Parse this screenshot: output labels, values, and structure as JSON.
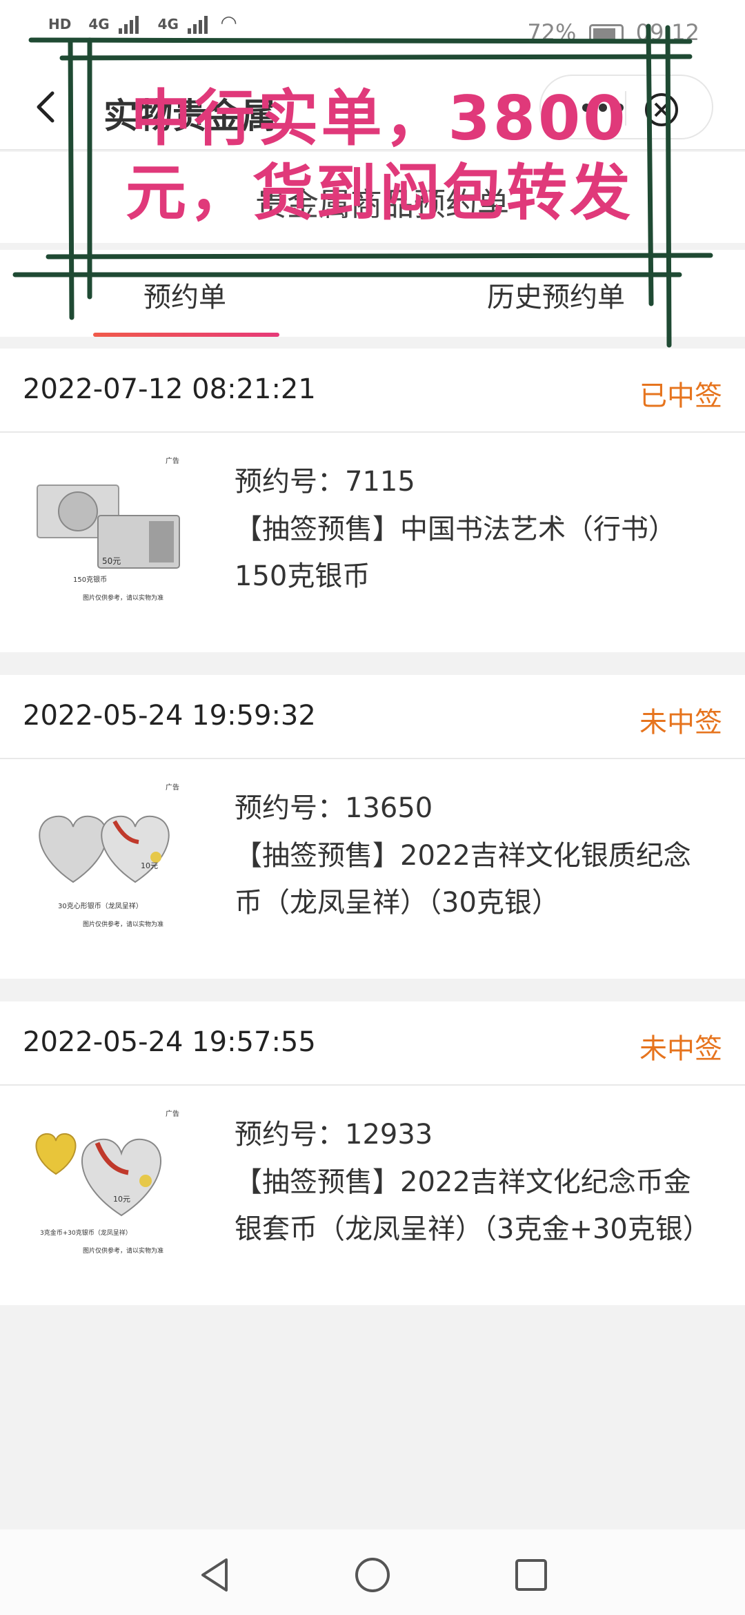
{
  "status_bar": {
    "left_badges": [
      "HD",
      "HD"
    ],
    "network_1": "4G",
    "network_2": "4G",
    "battery": "72%",
    "time": "09:12"
  },
  "titlebar": {
    "title": "实物贵金属",
    "back_icon": "chevron-left-icon",
    "more_icon": "more-dots-icon",
    "close_icon": "close-circle-icon"
  },
  "notice": {
    "text": "贵金属商品预约单"
  },
  "overlay": {
    "line1": "中行实单，3800",
    "line2": "元，货到闷包转发",
    "color": "#e0397a",
    "line_color": "#1f4a33"
  },
  "tabs": [
    {
      "label": "预约单",
      "active": true
    },
    {
      "label": "历史预约单",
      "active": false
    }
  ],
  "orders": [
    {
      "date": "2022-07-12 08:21:21",
      "result": "已中签",
      "reserve_no": "预约号：7115",
      "title": "【抽签预售】中国书法艺术（行书）150克银币",
      "thumb": {
        "ad": "广告",
        "caption": "150克银币",
        "note": "图片仅供参考，请以实物为准",
        "face_value": "50元"
      }
    },
    {
      "date": "2022-05-24 19:59:32",
      "result": "未中签",
      "reserve_no": "预约号：13650",
      "title": "【抽签预售】2022吉祥文化银质纪念币（龙凤呈祥）（30克银）",
      "thumb": {
        "ad": "广告",
        "caption": "30克心形银币（龙凤呈祥）",
        "note": "图片仅供参考，请以实物为准",
        "face_value": "10元"
      }
    },
    {
      "date": "2022-05-24 19:57:55",
      "result": "未中签",
      "reserve_no": "预约号：12933",
      "title": "【抽签预售】2022吉祥文化纪念币金银套币（龙凤呈祥）（3克金+30克银）",
      "thumb": {
        "ad": "广告",
        "caption": "3克金币+30克银币（龙凤呈祥）",
        "note": "图片仅供参考，请以实物为准",
        "face_value": "10元"
      }
    }
  ],
  "colors": {
    "accent_orange": "#e6741e",
    "tab_indicator_start": "#f05a4a",
    "tab_indicator_end": "#e63a78",
    "background": "#f2f2f2"
  },
  "navbar": {
    "back_icon": "triangle-back-icon",
    "home_icon": "circle-home-icon",
    "recents_icon": "square-recents-icon"
  }
}
